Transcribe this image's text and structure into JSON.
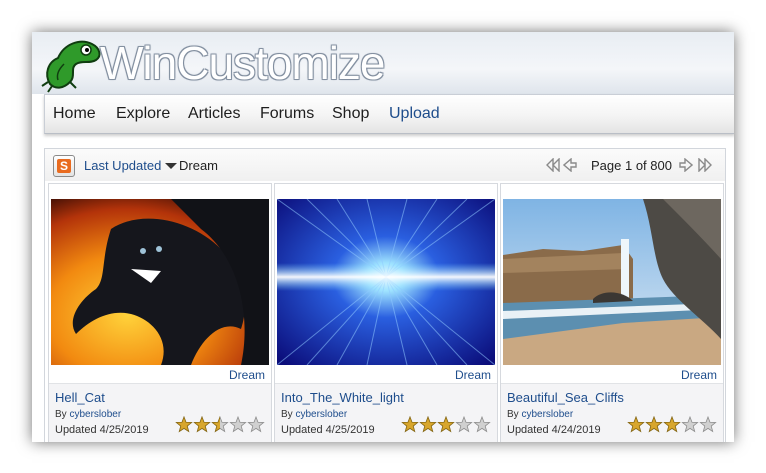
{
  "brand": {
    "logo_text": "WinCustomize"
  },
  "nav": {
    "items": [
      {
        "label": "Home"
      },
      {
        "label": "Explore"
      },
      {
        "label": "Articles"
      },
      {
        "label": "Forums"
      },
      {
        "label": "Shop"
      },
      {
        "label": "Upload"
      }
    ],
    "active": "Upload"
  },
  "toolbar": {
    "sort_label": "Last Updated",
    "filter_label": "Dream",
    "page_label": "Page 1 of 800"
  },
  "colors": {
    "link": "#1e4d8c",
    "star_filled": "#d8a62c",
    "star_empty": "#d0d0d0",
    "sort_icon": "#e96b1f"
  },
  "cards": [
    {
      "category": "Dream",
      "title": "Hell_Cat",
      "by_prefix": "By",
      "author": "cyberslober",
      "updated": "Updated 4/25/2019",
      "rating": 2.5
    },
    {
      "category": "Dream",
      "title": "Into_The_White_light",
      "by_prefix": "By",
      "author": "cyberslober",
      "updated": "Updated 4/25/2019",
      "rating": 3
    },
    {
      "category": "Dream",
      "title": "Beautiful_Sea_Cliffs",
      "by_prefix": "By",
      "author": "cyberslober",
      "updated": "Updated 4/24/2019",
      "rating": 3
    }
  ]
}
